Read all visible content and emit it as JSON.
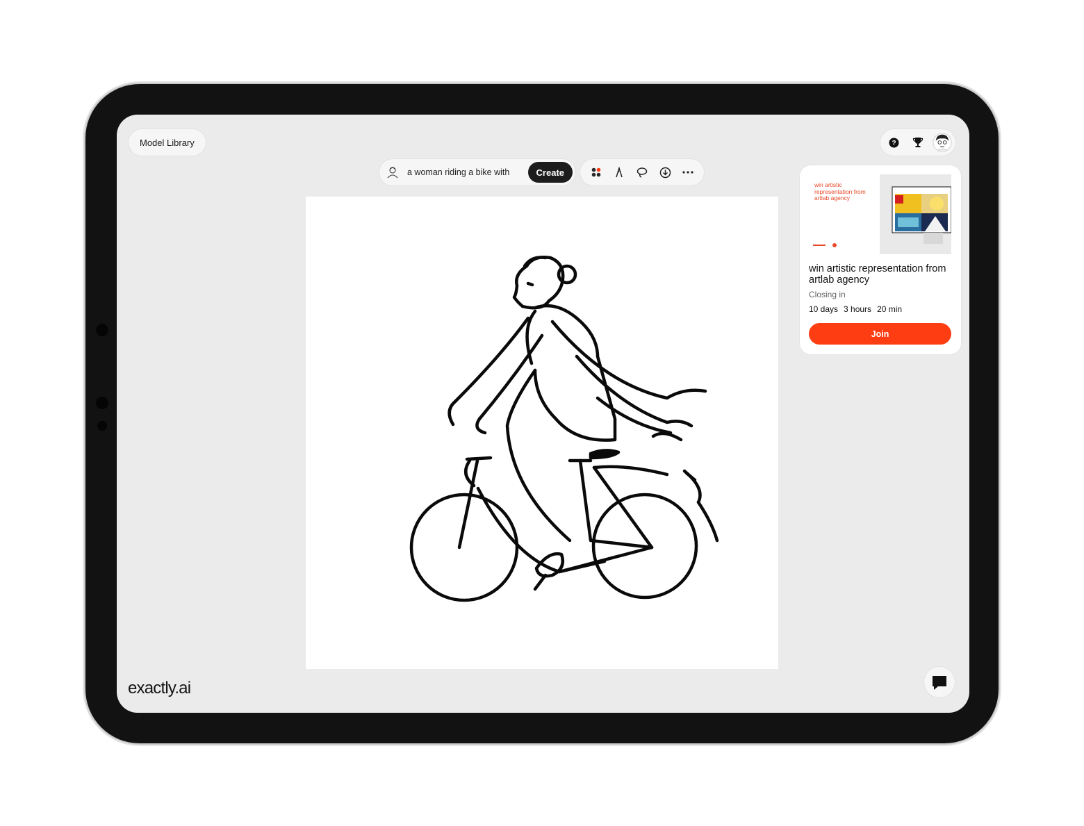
{
  "header": {
    "model_library_label": "Model Library"
  },
  "prompt": {
    "value": "a woman riding a bike with",
    "create_label": "Create"
  },
  "tools": [
    "palette-icon",
    "pen-icon",
    "lasso-icon",
    "download-icon",
    "more-icon"
  ],
  "top_right_icons": [
    "help-icon",
    "trophy-icon",
    "avatar"
  ],
  "canvas": {
    "subject": "line drawing of a woman riding a bicycle"
  },
  "card": {
    "thumb_text": "win artistic representation from artlab agency",
    "title": "win artistic representation from artlab agency",
    "closing_label": "Closing in",
    "countdown": [
      "10 days",
      "3 hours",
      "20 min"
    ],
    "join_label": "Join"
  },
  "brand": {
    "logo": "exactly.ai"
  },
  "colors": {
    "accent": "#ff3d12",
    "screen_bg": "#ebebeb",
    "create_bg": "#1c1c1c"
  }
}
